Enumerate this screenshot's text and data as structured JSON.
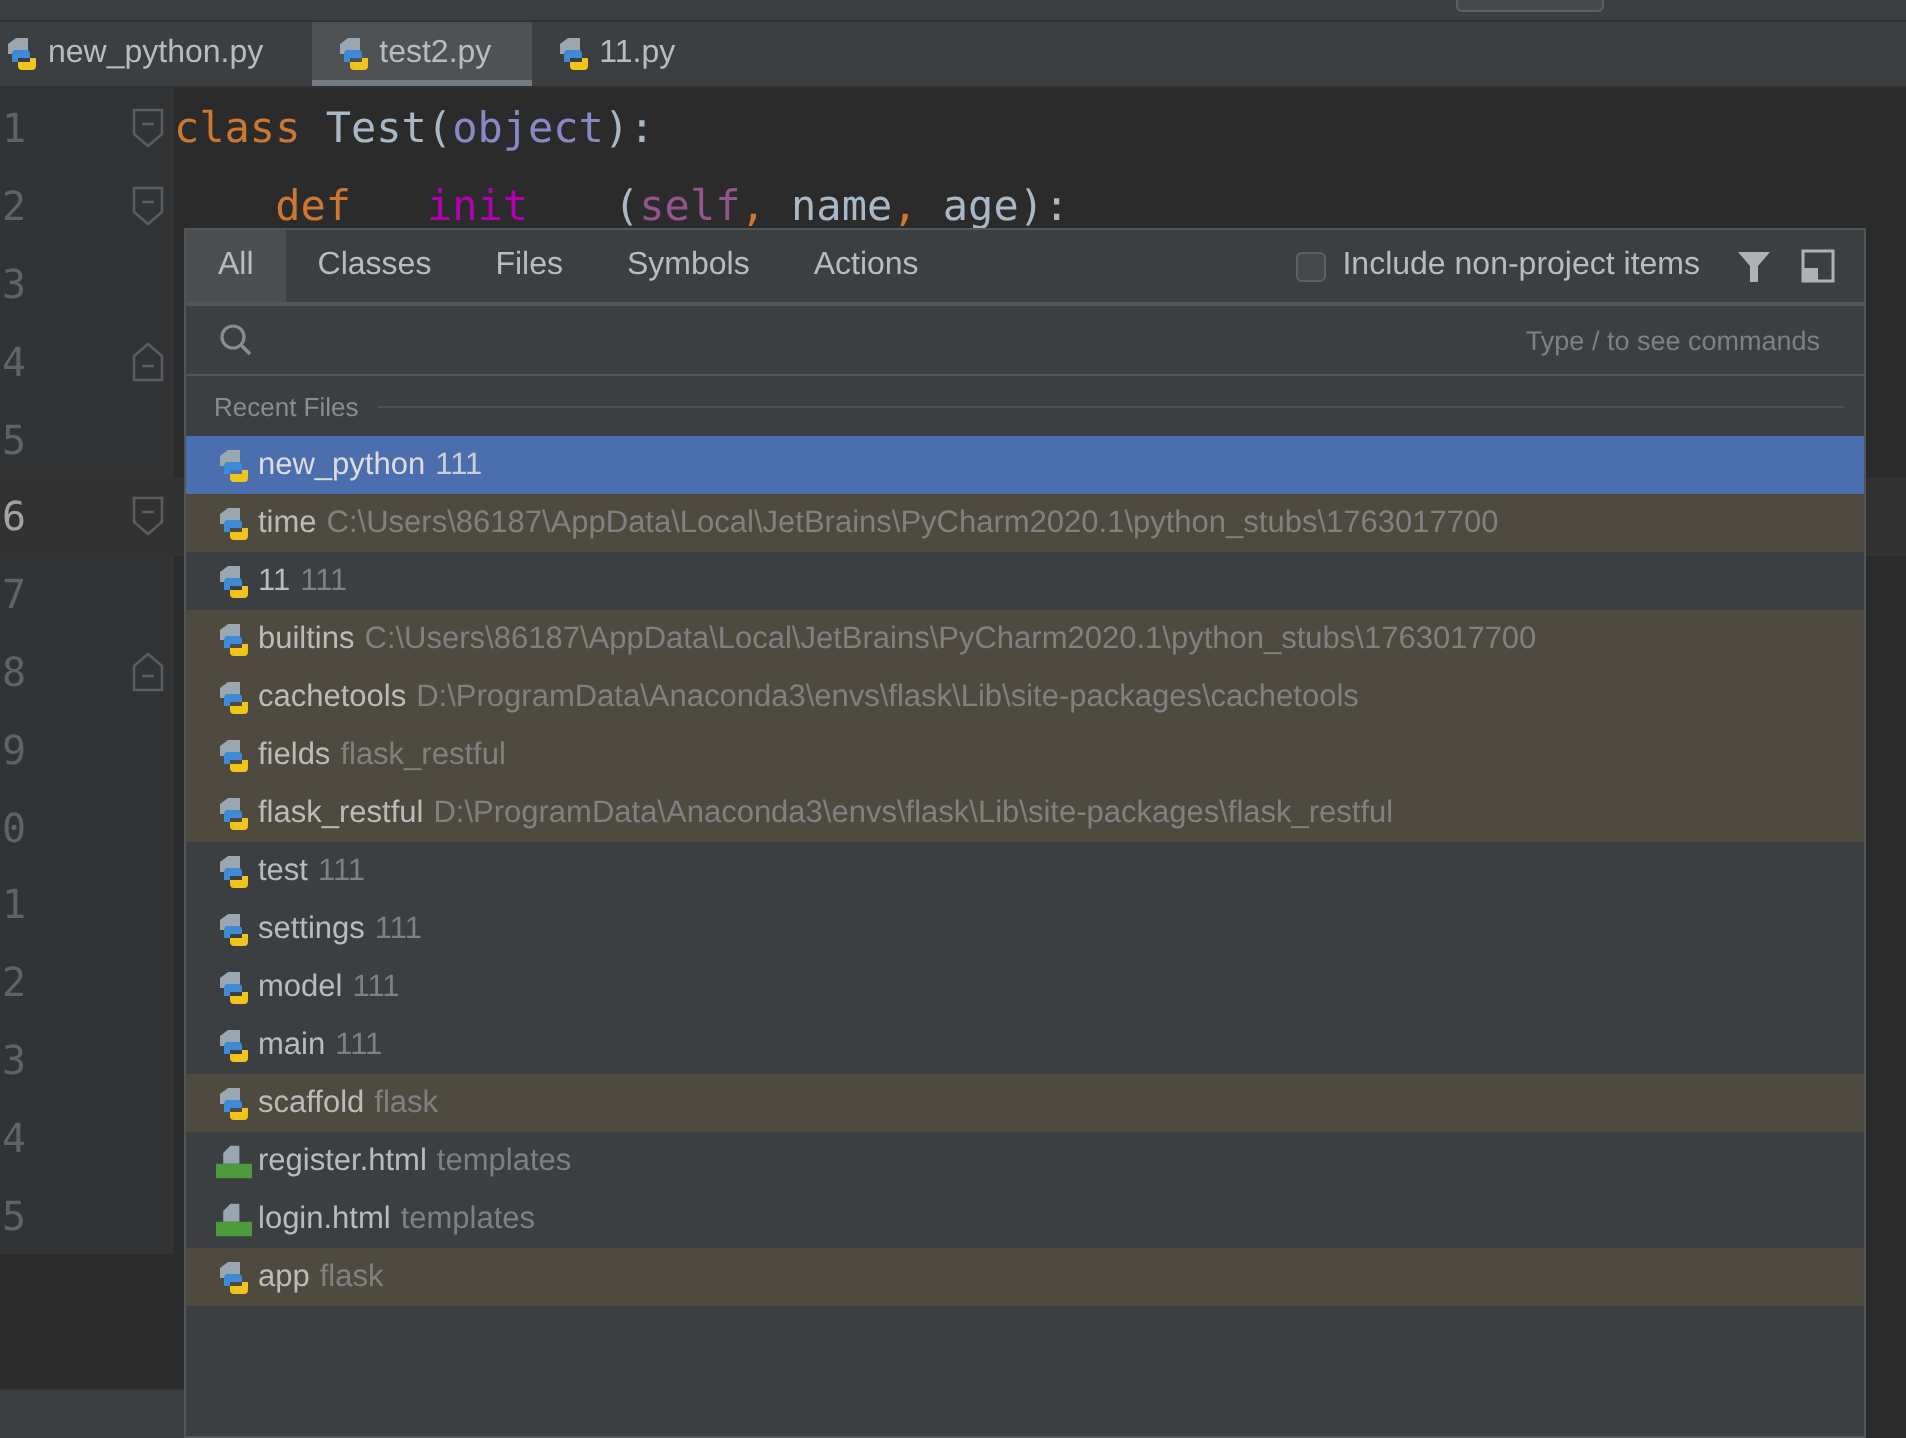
{
  "editor_tabs": [
    {
      "label": "new_python.py",
      "selected": false
    },
    {
      "label": "test2.py",
      "selected": true
    },
    {
      "label": "11.py",
      "selected": false
    }
  ],
  "editor": {
    "lines": [
      {
        "number": "1",
        "current": false,
        "kind": "fold-start",
        "tokens": [
          {
            "kind": "keyword",
            "text": "class "
          },
          {
            "kind": "plain",
            "text": "Test("
          },
          {
            "kind": "builtin",
            "text": "object"
          },
          {
            "kind": "plain",
            "text": "):"
          }
        ]
      },
      {
        "number": "2",
        "current": false,
        "kind": "fold-start",
        "tokens": [
          {
            "kind": "keyword",
            "text": "    def"
          },
          {
            "kind": "magic",
            "text": "init"
          },
          {
            "kind": "plain",
            "text": "("
          },
          {
            "kind": "self",
            "text": "self"
          },
          {
            "kind": "keyword",
            "text": ","
          },
          {
            "kind": "plain",
            "text": " name"
          },
          {
            "kind": "keyword",
            "text": ","
          },
          {
            "kind": "plain",
            "text": " age):"
          }
        ]
      },
      {
        "number": "3",
        "current": false,
        "kind": "plain"
      },
      {
        "number": "4",
        "current": false,
        "kind": "fold-end"
      },
      {
        "number": "5",
        "current": false,
        "kind": "plain"
      },
      {
        "number": "6",
        "current": true,
        "kind": "fold-start"
      },
      {
        "number": "7",
        "current": false,
        "kind": "plain"
      },
      {
        "number": "8",
        "current": false,
        "kind": "fold-end"
      },
      {
        "number": "9",
        "current": false,
        "kind": "plain"
      },
      {
        "number": "0",
        "current": false,
        "kind": "plain"
      },
      {
        "number": "1",
        "current": false,
        "kind": "plain"
      },
      {
        "number": "2",
        "current": false,
        "kind": "plain"
      },
      {
        "number": "3",
        "current": false,
        "kind": "plain"
      },
      {
        "number": "4",
        "current": false,
        "kind": "plain"
      },
      {
        "number": "5",
        "current": false,
        "kind": "plain"
      }
    ]
  },
  "search_everywhere": {
    "tabs": [
      {
        "label": "All",
        "selected": true
      },
      {
        "label": "Classes",
        "selected": false
      },
      {
        "label": "Files",
        "selected": false
      },
      {
        "label": "Symbols",
        "selected": false
      },
      {
        "label": "Actions",
        "selected": false
      }
    ],
    "include_non_project": {
      "label": "Include non-project items",
      "checked": false
    },
    "hint": "Type / to see commands",
    "section": "Recent Files",
    "results": [
      {
        "name": "new_python",
        "detail": "111",
        "kind": "python",
        "non_project": false,
        "selected": true
      },
      {
        "name": "time",
        "detail": "C:\\Users\\86187\\AppData\\Local\\JetBrains\\PyCharm2020.1\\python_stubs\\1763017700",
        "kind": "python",
        "non_project": true,
        "selected": false
      },
      {
        "name": "11",
        "detail": "111",
        "kind": "python",
        "non_project": false,
        "selected": false
      },
      {
        "name": "builtins",
        "detail": "C:\\Users\\86187\\AppData\\Local\\JetBrains\\PyCharm2020.1\\python_stubs\\1763017700",
        "kind": "python",
        "non_project": true,
        "selected": false
      },
      {
        "name": "cachetools",
        "detail": "D:\\ProgramData\\Anaconda3\\envs\\flask\\Lib\\site-packages\\cachetools",
        "kind": "python",
        "non_project": true,
        "selected": false
      },
      {
        "name": "fields",
        "detail": "flask_restful",
        "kind": "python",
        "non_project": true,
        "selected": false
      },
      {
        "name": "flask_restful",
        "detail": "D:\\ProgramData\\Anaconda3\\envs\\flask\\Lib\\site-packages\\flask_restful",
        "kind": "python",
        "non_project": true,
        "selected": false
      },
      {
        "name": "test",
        "detail": "111",
        "kind": "python",
        "non_project": false,
        "selected": false
      },
      {
        "name": "settings",
        "detail": "111",
        "kind": "python",
        "non_project": false,
        "selected": false
      },
      {
        "name": "model",
        "detail": "111",
        "kind": "python",
        "non_project": false,
        "selected": false
      },
      {
        "name": "main",
        "detail": "111",
        "kind": "python",
        "non_project": false,
        "selected": false
      },
      {
        "name": "scaffold",
        "detail": "flask",
        "kind": "python",
        "non_project": true,
        "selected": false
      },
      {
        "name": "register.html",
        "detail": "templates",
        "kind": "html",
        "non_project": false,
        "selected": false
      },
      {
        "name": "login.html",
        "detail": "templates",
        "kind": "html",
        "non_project": false,
        "selected": false
      },
      {
        "name": "app",
        "detail": "flask",
        "kind": "python",
        "non_project": true,
        "selected": false
      }
    ]
  }
}
